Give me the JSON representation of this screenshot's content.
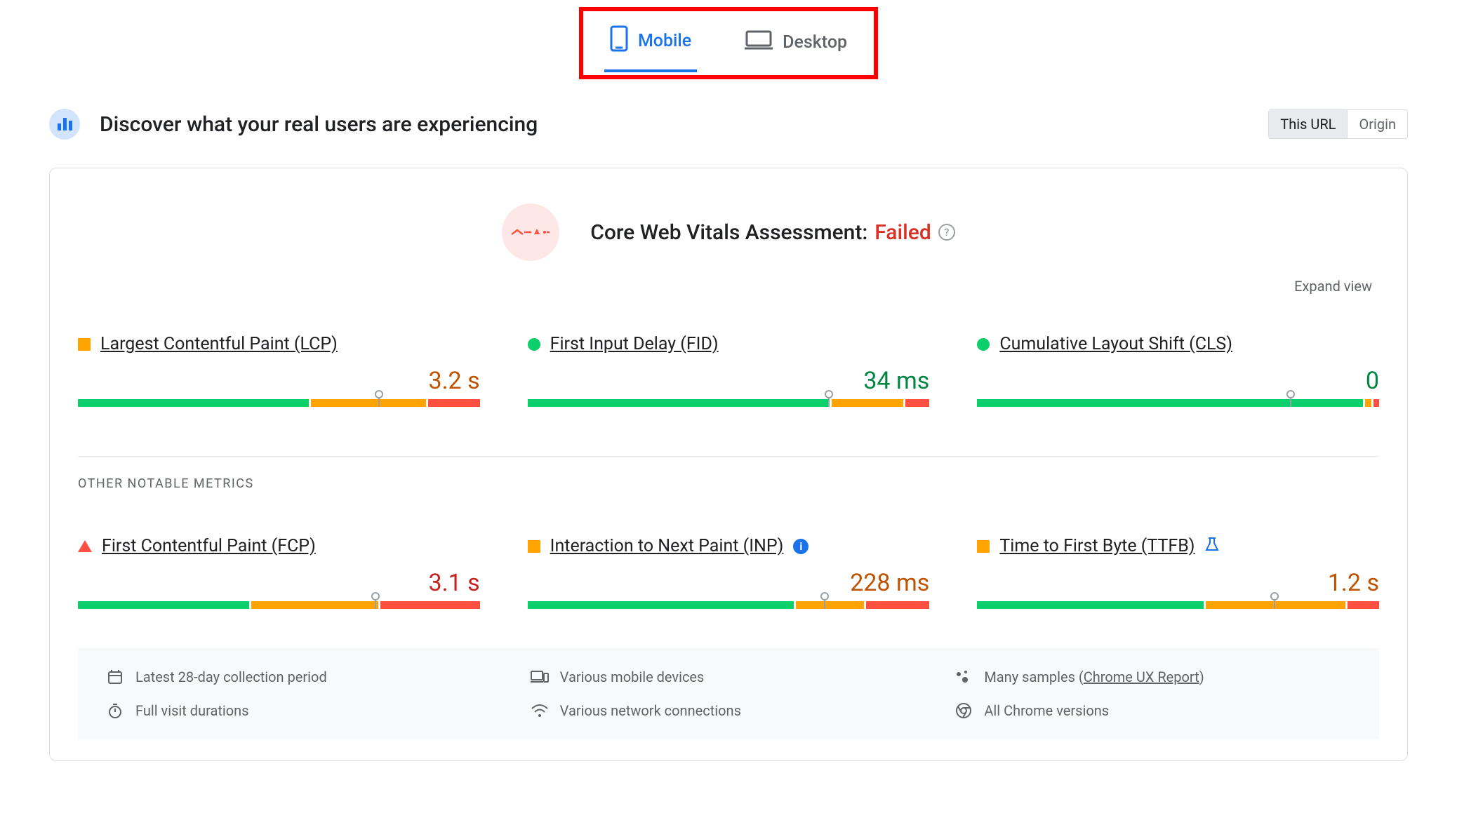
{
  "tabs": {
    "mobile": "Mobile",
    "desktop": "Desktop"
  },
  "header": {
    "title": "Discover what your real users are experiencing",
    "toggle_this_url": "This URL",
    "toggle_origin": "Origin"
  },
  "assessment": {
    "label": "Core Web Vitals Assessment: ",
    "status": "Failed",
    "expand": "Expand view"
  },
  "metrics": {
    "lcp": {
      "name": "Largest Contentful Paint (LCP)",
      "value": "3.2 s",
      "status": "orange",
      "shape": "square",
      "bar": {
        "green": 58,
        "orange": 29,
        "red": 13,
        "pin": 75
      }
    },
    "fid": {
      "name": "First Input Delay (FID)",
      "value": "34 ms",
      "status": "green",
      "shape": "circle",
      "bar": {
        "green": 76,
        "orange": 18,
        "red": 6,
        "pin": 75
      }
    },
    "cls": {
      "name": "Cumulative Layout Shift (CLS)",
      "value": "0",
      "status": "green",
      "shape": "circle",
      "bar": {
        "green": 97,
        "orange": 1.5,
        "red": 1.5,
        "pin": 78
      }
    },
    "section_label": "OTHER NOTABLE METRICS",
    "fcp": {
      "name": "First Contentful Paint (FCP)",
      "value": "3.1 s",
      "status": "red",
      "shape": "triangle",
      "bar": {
        "green": 43,
        "orange": 32,
        "red": 25,
        "pin": 74
      }
    },
    "inp": {
      "name": "Interaction to Next Paint (INP)",
      "value": "228 ms",
      "status": "orange",
      "shape": "square",
      "has_info": true,
      "bar": {
        "green": 67,
        "orange": 17,
        "red": 16,
        "pin": 74
      }
    },
    "ttfb": {
      "name": "Time to First Byte (TTFB)",
      "value": "1.2 s",
      "status": "orange",
      "shape": "square",
      "has_flask": true,
      "bar": {
        "green": 57,
        "orange": 35,
        "red": 8,
        "pin": 74
      }
    }
  },
  "footer": {
    "period": "Latest 28-day collection period",
    "devices": "Various mobile devices",
    "samples_prefix": "Many samples (",
    "samples_link": "Chrome UX Report",
    "samples_suffix": ")",
    "durations": "Full visit durations",
    "network": "Various network connections",
    "chrome": "All Chrome versions"
  }
}
